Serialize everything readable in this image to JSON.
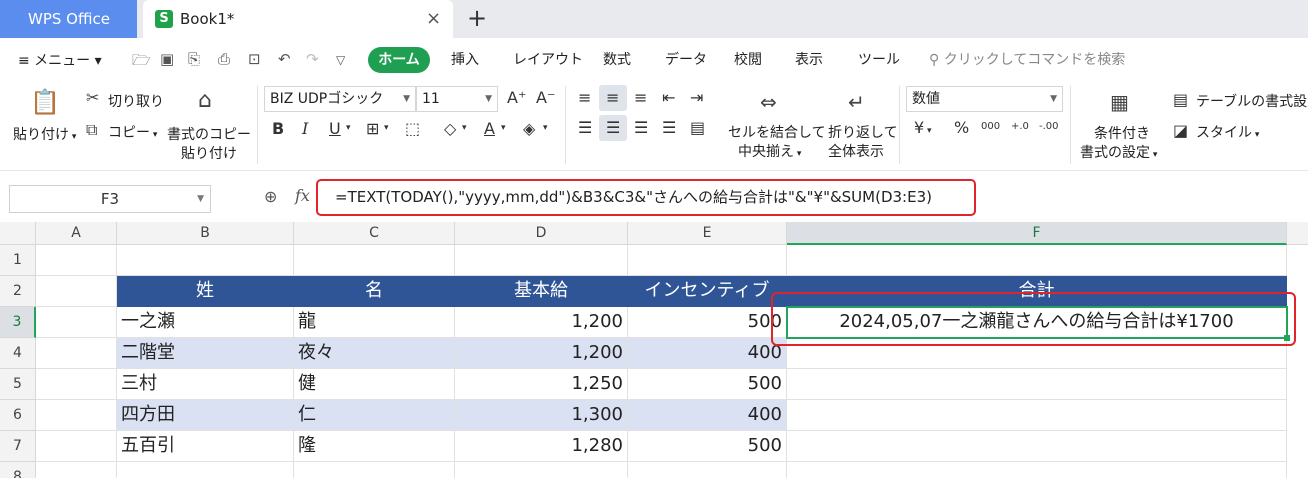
{
  "tabs": {
    "app": "WPS Office",
    "book": "Book1*",
    "book_logo": "S",
    "close": "×",
    "add": "+"
  },
  "menu": {
    "hamburger_label": "≡ メニュー ▾",
    "tabs": [
      "ホーム",
      "挿入",
      "レイアウト",
      "数式",
      "データ",
      "校閲",
      "表示",
      "ツール"
    ],
    "search_placeholder": "クリックしてコマンドを検索"
  },
  "ribbon": {
    "paste": "貼り付け",
    "cut": "切り取り",
    "copy": "コピー",
    "format_painter_1": "書式のコピー",
    "format_painter_2": "貼り付け",
    "font_name": "BIZ UDPゴシック",
    "font_size": "11",
    "merge_1": "セルを結合して",
    "merge_2": "中央揃え",
    "wrap_1": "折り返して",
    "wrap_2": "全体表示",
    "number_format": "数値",
    "cond_format_1": "条件付き",
    "cond_format_2": "書式の設定",
    "table_format": "テーブルの書式設定",
    "styles": "スタイル",
    "bold": "B",
    "italic": "I",
    "underline": "U",
    "font_color": "A",
    "currency": "¥",
    "percent": "%",
    "thousands": "000",
    "increase_decimal": "+.0",
    "decrease_decimal": "-.00"
  },
  "formula_bar": {
    "name_box": "F3",
    "fx": "fx",
    "formula": "=TEXT(TODAY(),\"yyyy,mm,dd\")&B3&C3&\"さんへの給与合計は\"&\"¥\"&SUM(D3:E3)"
  },
  "sheet": {
    "columns": [
      "A",
      "B",
      "C",
      "D",
      "E",
      "F"
    ],
    "rows": [
      "1",
      "2",
      "3",
      "4",
      "5",
      "6",
      "7",
      "8"
    ],
    "selected_cell": "F3",
    "headers": [
      "姓",
      "名",
      "基本給",
      "インセンティブ",
      "合計"
    ],
    "data": [
      {
        "last": "一之瀬",
        "first": "龍",
        "base": "1,200",
        "incentive": "500",
        "total": "2024,05,07一之瀬龍さんへの給与合計は¥1700"
      },
      {
        "last": "二階堂",
        "first": "夜々",
        "base": "1,200",
        "incentive": "400",
        "total": ""
      },
      {
        "last": "三村",
        "first": "健",
        "base": "1,250",
        "incentive": "500",
        "total": ""
      },
      {
        "last": "四方田",
        "first": "仁",
        "base": "1,300",
        "incentive": "400",
        "total": ""
      },
      {
        "last": "五百引",
        "first": "隆",
        "base": "1,280",
        "incentive": "500",
        "total": ""
      }
    ]
  },
  "colors": {
    "accent_green": "#1e9f52",
    "header_blue": "#2f5597",
    "band_blue": "#dae1f3",
    "highlight_red": "#e0242c",
    "wps_blue": "#5b8def"
  }
}
